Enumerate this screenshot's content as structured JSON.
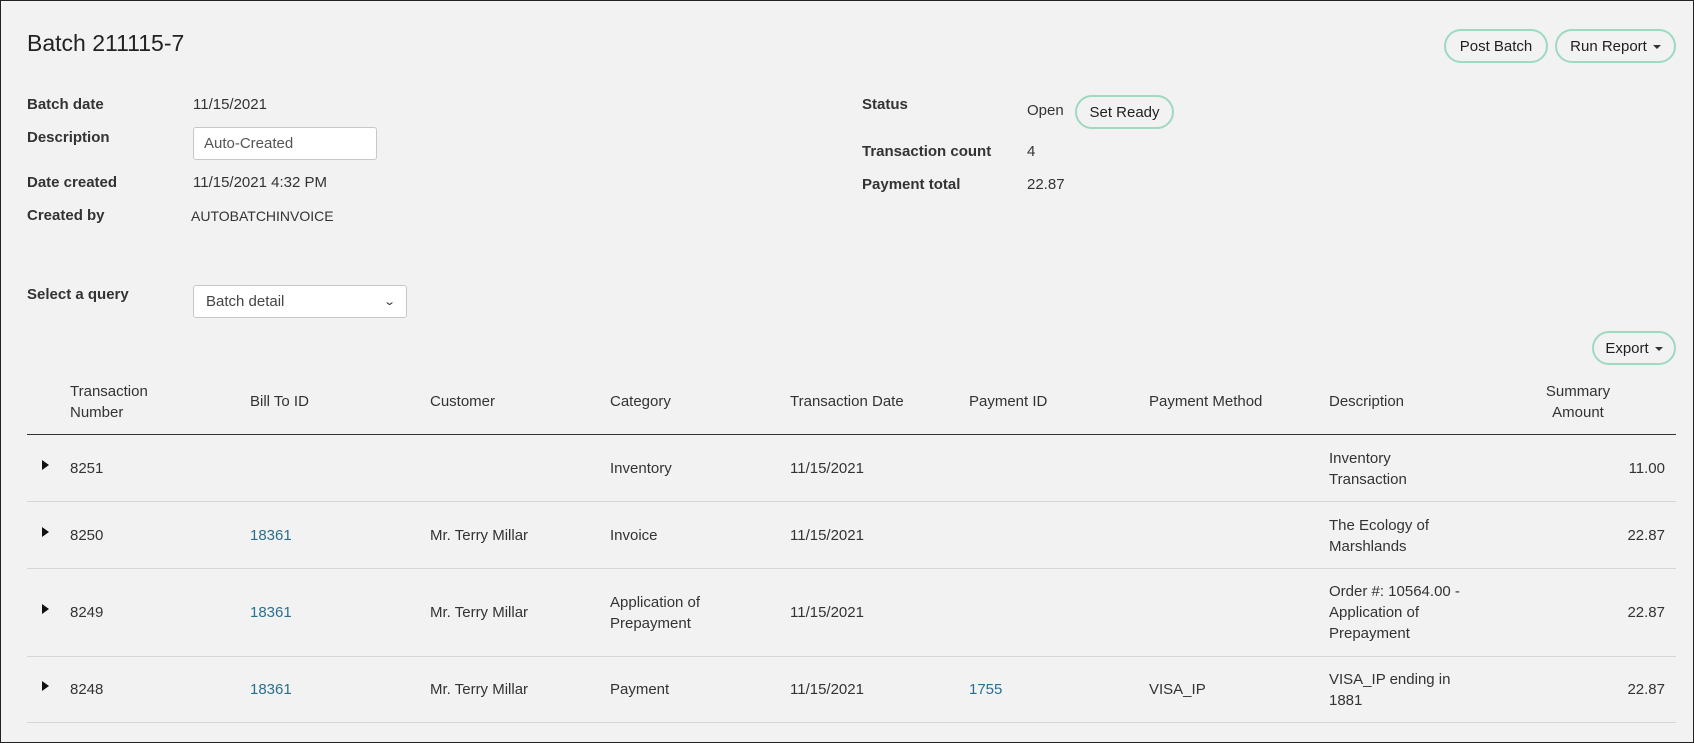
{
  "page": {
    "title": "Batch 211115-7",
    "post_batch_label": "Post Batch",
    "run_report_label": "Run Report",
    "export_label": "Export"
  },
  "details": {
    "batch_date_label": "Batch date",
    "batch_date": "11/15/2021",
    "description_label": "Description",
    "description_value": "Auto-Created",
    "date_created_label": "Date created",
    "date_created": "11/15/2021 4:32 PM",
    "created_by_label": "Created by",
    "created_by": "AUTOBATCHINVOICE",
    "status_label": "Status",
    "status": "Open",
    "set_ready_label": "Set Ready",
    "transaction_count_label": "Transaction count",
    "transaction_count": "4",
    "payment_total_label": "Payment total",
    "payment_total": "22.87"
  },
  "query": {
    "label": "Select a query",
    "selected": "Batch detail"
  },
  "table": {
    "columns": [
      "Transaction\nNumber",
      "Bill To ID",
      "Customer",
      "Category",
      "Transaction Date",
      "Payment ID",
      "Payment Method",
      "Description",
      "Summary\nAmount"
    ],
    "rows": [
      {
        "number": "8251",
        "bill_to": "",
        "customer": "",
        "category": "Inventory",
        "date": "11/15/2021",
        "payment_id": "",
        "method": "",
        "description": "Inventory\nTransaction",
        "amount": "11.00"
      },
      {
        "number": "8250",
        "bill_to": "18361",
        "customer": "Mr. Terry Millar",
        "category": "Invoice",
        "date": "11/15/2021",
        "payment_id": "",
        "method": "",
        "description": "The Ecology of\nMarshlands",
        "amount": "22.87"
      },
      {
        "number": "8249",
        "bill_to": "18361",
        "customer": "Mr. Terry Millar",
        "category": "Application of\nPrepayment",
        "date": "11/15/2021",
        "payment_id": "",
        "method": "",
        "description": "Order #: 10564.00 -\nApplication of\nPrepayment",
        "amount": "22.87"
      },
      {
        "number": "8248",
        "bill_to": "18361",
        "customer": "Mr. Terry Millar",
        "category": "Payment",
        "date": "11/15/2021",
        "payment_id": "1755",
        "method": "VISA_IP",
        "description": "VISA_IP ending in\n1881",
        "amount": "22.87"
      }
    ]
  },
  "colors": {
    "accent_border": "#9fd9bf",
    "link": "#2a6f8e",
    "background": "#f2f2f2"
  }
}
